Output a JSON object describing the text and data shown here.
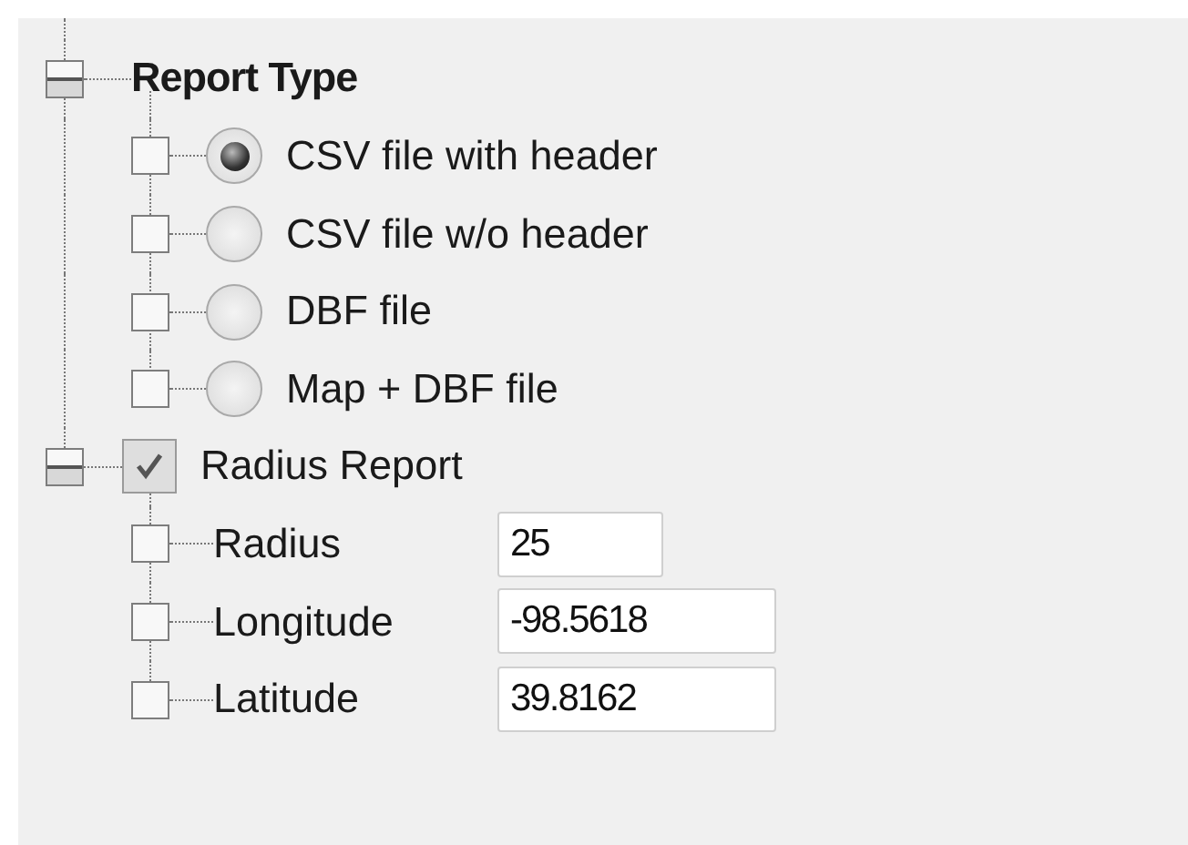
{
  "tree": [
    {
      "kind": "group",
      "label": "Report Type",
      "expanded": true,
      "children": [
        {
          "kind": "radio",
          "label": "CSV file with header",
          "selected": true
        },
        {
          "kind": "radio",
          "label": "CSV file w/o header",
          "selected": false
        },
        {
          "kind": "radio",
          "label": "DBF file",
          "selected": false
        },
        {
          "kind": "radio",
          "label": "Map + DBF file",
          "selected": false
        }
      ]
    },
    {
      "kind": "checkbox",
      "label": "Radius Report",
      "checked": true,
      "expanded": true,
      "children": [
        {
          "kind": "short-field",
          "label": "Radius",
          "value": "25"
        },
        {
          "kind": "field",
          "label": "Longitude",
          "value": "-98.5618"
        },
        {
          "kind": "field",
          "label": "Latitude",
          "value": "39.8162"
        }
      ]
    }
  ]
}
